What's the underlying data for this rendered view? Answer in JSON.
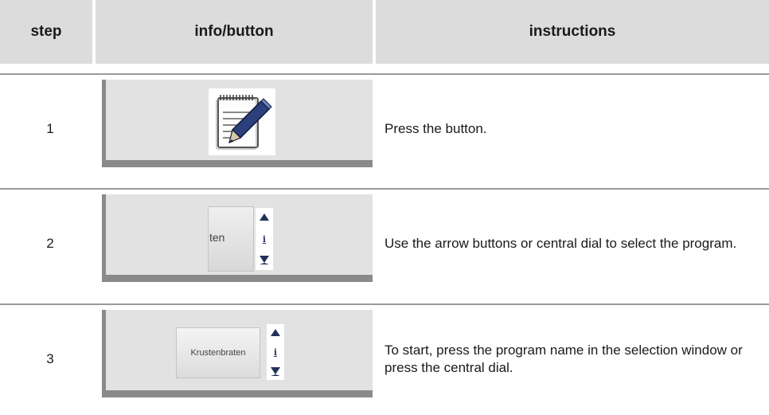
{
  "header": {
    "step_label": "step",
    "info_label": "info/button",
    "instructions_label": "instructions"
  },
  "rows": [
    {
      "step": "1",
      "button": {
        "icon": "notepad-edit-icon"
      },
      "instruction": "Press the button."
    },
    {
      "step": "2",
      "button": {
        "icon": "list-selector-icon",
        "list_text": "ten"
      },
      "instruction": "Use the arrow buttons or central dial to select the program."
    },
    {
      "step": "3",
      "button": {
        "icon": "list-selector-icon",
        "list_text": "Krustenbraten"
      },
      "instruction": "To start, press the program name in the selection window or press the central dial."
    }
  ],
  "colors": {
    "header_bg": "#dcdcdc",
    "panel_bg": "#e2e2e2",
    "panel_border": "#8a8a8a",
    "divider": "#9a9a9a",
    "arrow": "#22305a"
  }
}
